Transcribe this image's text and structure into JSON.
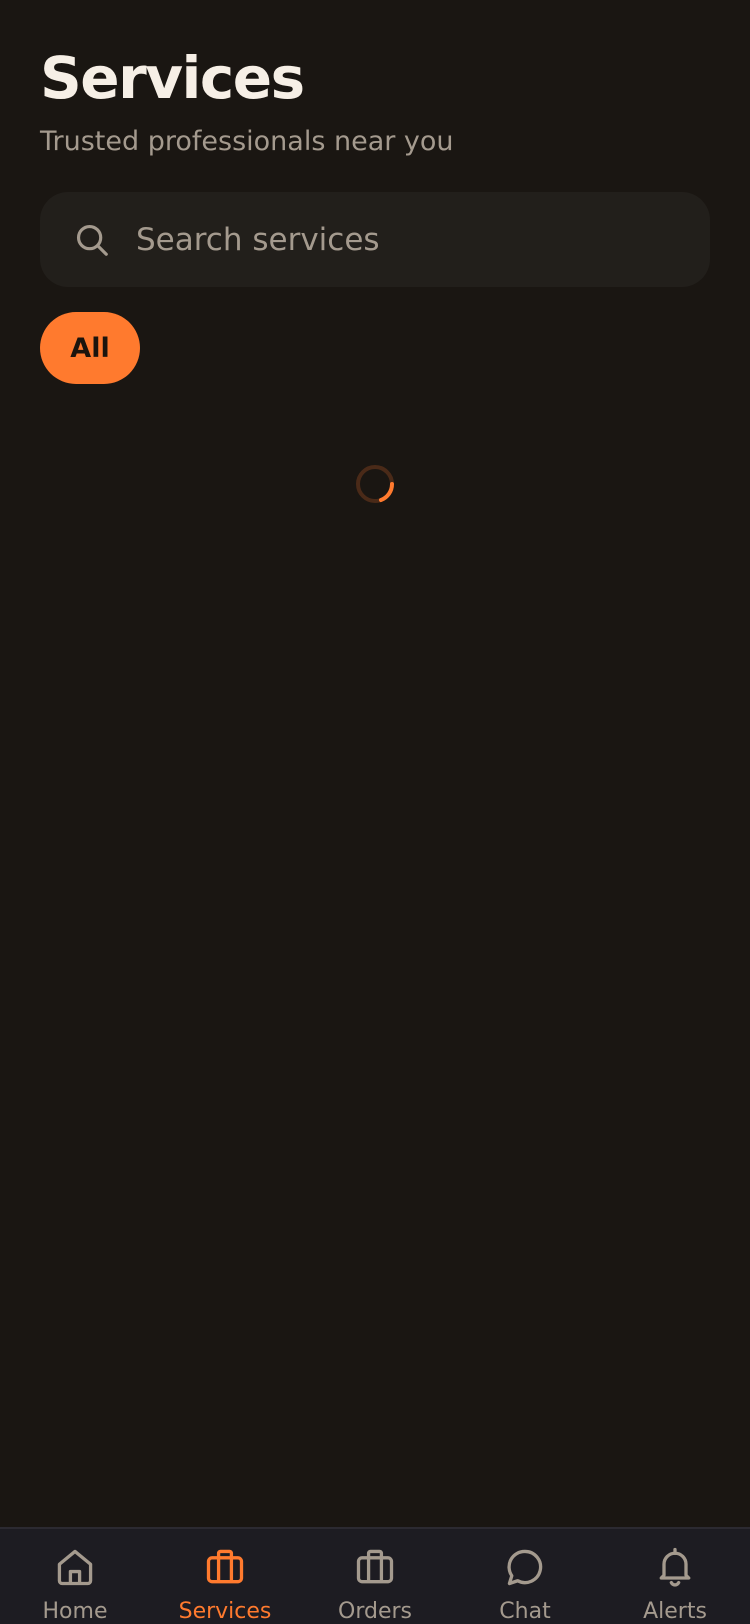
{
  "header": {
    "title": "Services",
    "subtitle": "Trusted professionals near you"
  },
  "search": {
    "placeholder": "Search services",
    "value": ""
  },
  "filters": [
    {
      "label": "All",
      "selected": true
    }
  ],
  "loading": true,
  "colors": {
    "background": "#1a1612",
    "accent": "#ff7a2e",
    "text_primary": "#f6efe6",
    "text_muted": "#a49a8e",
    "nav_background": "#1d1c22"
  },
  "bottom_nav": {
    "items": [
      {
        "label": "Home",
        "icon": "home-icon",
        "active": false
      },
      {
        "label": "Services",
        "icon": "briefcase-icon",
        "active": true
      },
      {
        "label": "Orders",
        "icon": "briefcase-icon",
        "active": false
      },
      {
        "label": "Chat",
        "icon": "chat-bubble-icon",
        "active": false
      },
      {
        "label": "Alerts",
        "icon": "bell-icon",
        "active": false
      }
    ]
  }
}
